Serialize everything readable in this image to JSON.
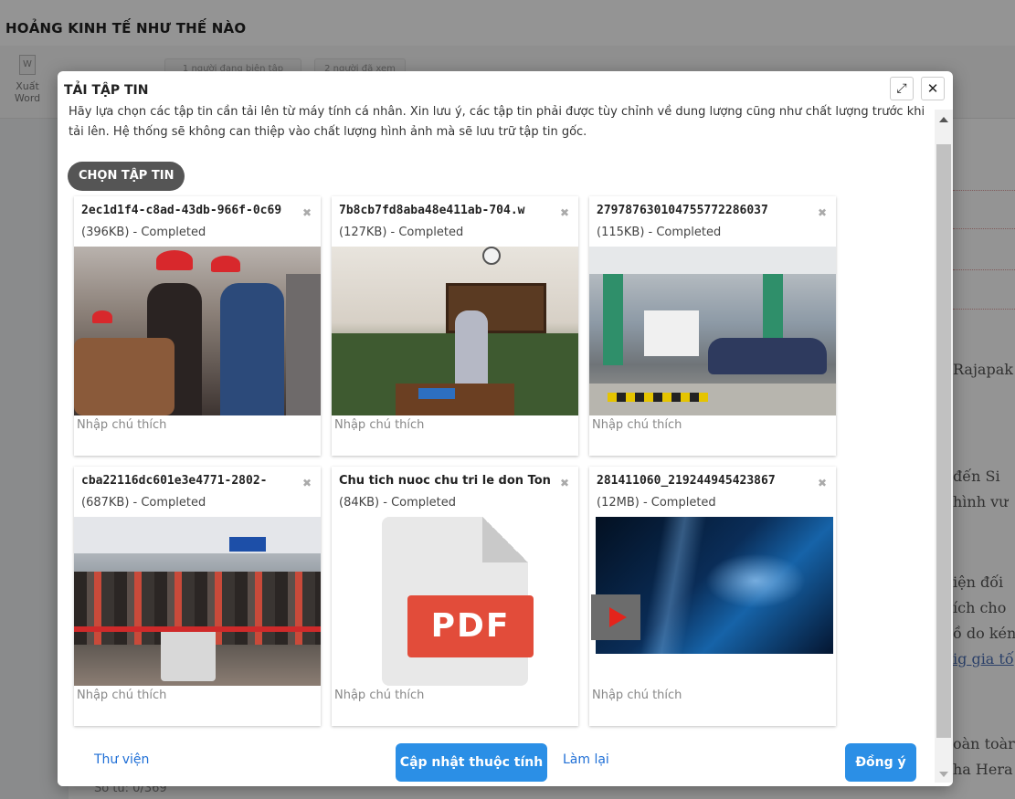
{
  "background": {
    "title": "HOẢNG KINH TẾ NHƯ THẾ NÀO",
    "toolbar": {
      "export_word_label": "Xuất Word",
      "word_icon_letter": "W",
      "editing_badge": "1 người đang biên tập",
      "viewed_badge": "2 người đã xem"
    },
    "right_text": [
      "Rajapak",
      "đến Si",
      "hình vư",
      "iện đối",
      "ích cho",
      "ồ do kén",
      "ig gia tố",
      "oàn toàr",
      "ha Hera"
    ],
    "word_counter": "Số từ: 0/369"
  },
  "modal": {
    "title": "TẢI TẬP TIN",
    "expand_icon": "expand-icon",
    "close_icon": "close-icon",
    "intro_text": "Hãy lựa chọn các tập tin cần tải lên từ máy tính cá nhân. Xin lưu ý, các tập tin phải được tùy chỉnh về dung lượng cũng như chất lượng trước khi tải lên. Hệ thống sẽ không can thiệp vào chất lượng hình ảnh mà sẽ lưu trữ tập tin gốc.",
    "choose_files_label": "CHỌN TẬP TIN",
    "files": [
      {
        "name": "2ec1d1f4-c8ad-43db-966f-0c69",
        "meta": "(396KB) - Completed",
        "caption_placeholder": "Nhập chú thích",
        "thumb": "photo-crowd-red-hats"
      },
      {
        "name": "7b8cb7fd8aba48e411ab-704.w",
        "meta": "(127KB) - Completed",
        "caption_placeholder": "Nhập chú thích",
        "thumb": "photo-courtroom"
      },
      {
        "name": "279787630104755772286037",
        "meta": "(115KB) - Completed",
        "caption_placeholder": "Nhập chú thích",
        "thumb": "photo-toll-station"
      },
      {
        "name": "cba22116dc601e3e4771-2802-",
        "meta": "(687KB) - Completed",
        "caption_placeholder": "Nhập chú thích",
        "thumb": "photo-airport-crowd"
      },
      {
        "name": "Chu tich nuoc chu tri le don Ton",
        "meta": "(84KB) - Completed",
        "caption_placeholder": "Nhập chú thích",
        "thumb": "pdf-icon",
        "pdf_label": "PDF"
      },
      {
        "name": "281411060_219244945423867",
        "meta": "(12MB) - Completed",
        "caption_placeholder": "Nhập chú thích",
        "thumb": "video-thumbnail"
      }
    ],
    "remove_icon": "remove-icon",
    "footer": {
      "library_label": "Thư viện",
      "update_props_label": "Cập nhật thuộc tính",
      "reset_label": "Làm lại",
      "confirm_label": "Đồng ý"
    }
  },
  "colors": {
    "primary": "#2b8fe6",
    "link": "#1f6fd6",
    "pdf_red": "#e24c3a",
    "choose_button": "#555555"
  }
}
